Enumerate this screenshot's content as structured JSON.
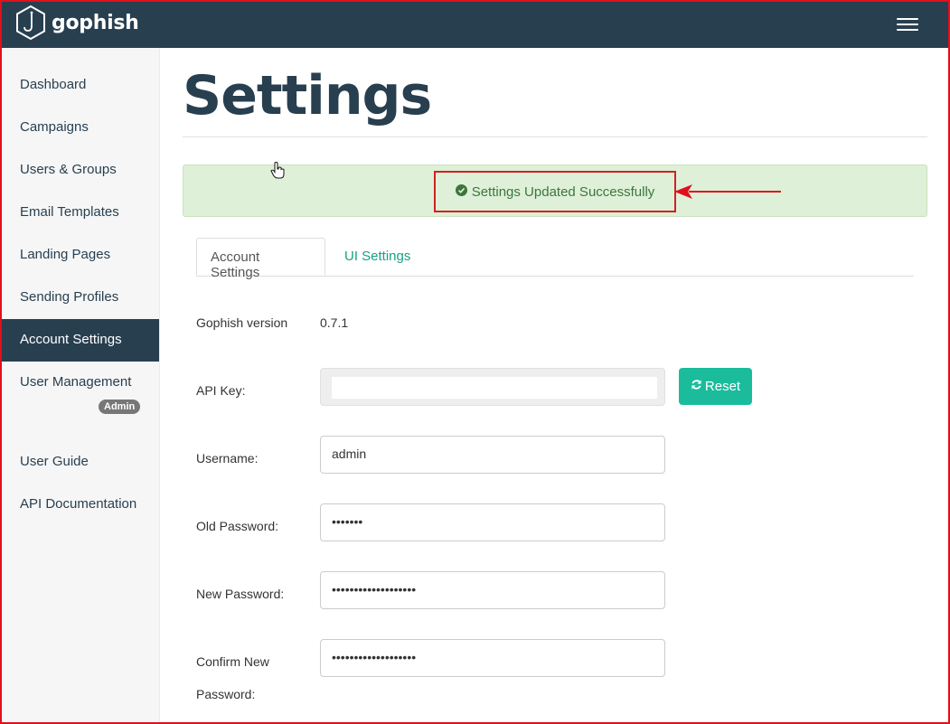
{
  "brand": {
    "name": "gophish",
    "logo_icon": "hook-hexagon-icon"
  },
  "navbar": {
    "menu_icon": "hamburger-menu-icon"
  },
  "sidebar": {
    "items": [
      {
        "label": "Dashboard"
      },
      {
        "label": "Campaigns"
      },
      {
        "label": "Users & Groups"
      },
      {
        "label": "Email Templates"
      },
      {
        "label": "Landing Pages"
      },
      {
        "label": "Sending Profiles"
      },
      {
        "label": "Account Settings",
        "active": true
      },
      {
        "label": "User Management",
        "badge": "Admin"
      },
      {
        "label": "User Guide"
      },
      {
        "label": "API Documentation"
      }
    ]
  },
  "main": {
    "title": "Settings",
    "alert": {
      "icon": "check-circle-icon",
      "message": "Settings Updated Successfully"
    },
    "tabs": [
      {
        "label": "Account Settings",
        "active": true
      },
      {
        "label": "UI Settings"
      }
    ],
    "form": {
      "version_label": "Gophish version",
      "version_value": "0.7.1",
      "api_key_label": "API Key:",
      "api_key_value": "",
      "reset_label": "Reset",
      "reset_icon": "refresh-icon",
      "username_label": "Username:",
      "username_value": "admin",
      "old_password_label": "Old Password:",
      "old_password_value": "•••••••",
      "new_password_label": "New Password:",
      "new_password_value": "•••••••••••••••••••",
      "confirm_password_label_1": "Confirm New",
      "confirm_password_label_2": "Password:",
      "confirm_password_value": "•••••••••••••••••••"
    }
  },
  "colors": {
    "navbar": "#283f50",
    "accent": "#1abc9c",
    "tab_link": "#16a085",
    "alert_bg": "#dff0d8",
    "alert_text": "#3c763d",
    "annotation": "#e0101a"
  }
}
